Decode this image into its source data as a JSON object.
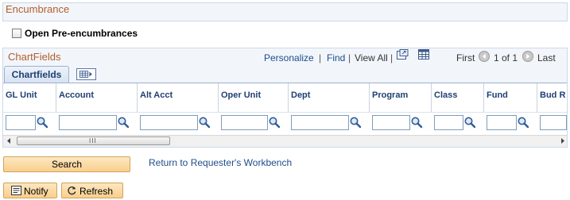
{
  "encumbrance": {
    "title": "Encumbrance"
  },
  "options": {
    "open_pre_encumbrances_label": "Open Pre-encumbrances",
    "open_pre_encumbrances_checked": false
  },
  "grid": {
    "title": "ChartFields",
    "nav": {
      "personalize": "Personalize",
      "find": "Find",
      "view_all": "View All",
      "separator": "|",
      "first": "First",
      "range": "1 of 1",
      "last": "Last"
    },
    "tabs": [
      {
        "label": "Chartfields",
        "active": true
      }
    ],
    "columns": [
      "GL Unit",
      "Account",
      "Alt Acct",
      "Oper Unit",
      "Dept",
      "Program",
      "Class",
      "Fund",
      "Bud R"
    ],
    "row_values": [
      "",
      "",
      "",
      "",
      "",
      "",
      "",
      "",
      ""
    ],
    "scroll_grip": "III"
  },
  "actions": {
    "search": "Search",
    "return_link": "Return to Requester's Workbench",
    "notify": "Notify",
    "refresh": "Refresh"
  },
  "icons": {
    "zoom": "zoom-icon",
    "grid": "grid-view-icon",
    "lookup": "magnifier-icon",
    "expand_tab": "show-all-columns-icon",
    "first_arrow": "arrow-left-icon",
    "last_arrow": "arrow-right-icon",
    "notify": "notify-icon",
    "refresh": "refresh-icon"
  },
  "colors": {
    "section_title": "#b25d2c",
    "link": "#1e4d8a",
    "header_text": "#1f3f73",
    "button": "#f8cf8d"
  }
}
